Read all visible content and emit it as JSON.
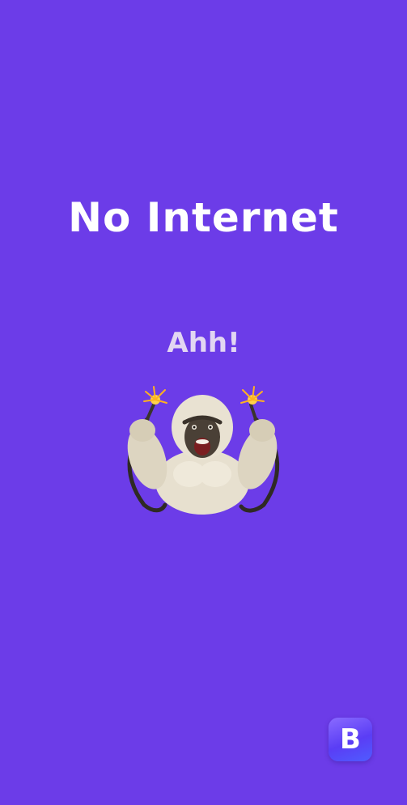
{
  "screen": {
    "title": "No Internet",
    "subtitle": "Ahh!",
    "illustration_icon": "angry-gorilla-holding-sparking-cables",
    "background_color": "#6c3ce8"
  },
  "brand": {
    "letter": "B",
    "icon": "b-app-logo"
  }
}
